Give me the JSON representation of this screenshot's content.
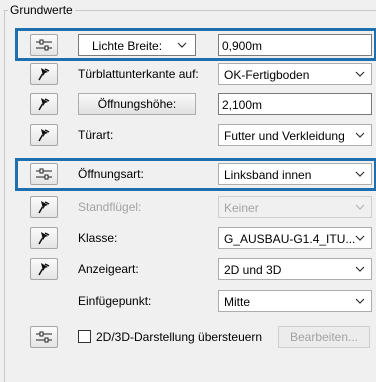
{
  "group": {
    "title": "Grundwerte"
  },
  "rows": {
    "lichte_breite": {
      "select_label": "Lichte Breite:",
      "value": "0,900m"
    },
    "tuerblatt": {
      "label": "Türblattunterkante auf:",
      "value": "OK-Fertigboden"
    },
    "oeffnungshoehe": {
      "button_label": "Öffnungshöhe:",
      "value": "2,100m"
    },
    "tuerart": {
      "label": "Türart:",
      "value": "Futter und Verkleidung"
    },
    "oeffnungsart": {
      "label": "Öffnungsart:",
      "value": "Linksband innen"
    },
    "standfluegel": {
      "label": "Standflügel:",
      "value": "Keiner"
    },
    "klasse": {
      "label": "Klasse:",
      "value": "G_AUSBAU-G1.4_ITU..."
    },
    "anzeigeart": {
      "label": "Anzeigeart:",
      "value": "2D und 3D"
    },
    "einfuegepunkt": {
      "label": "Einfügepunkt:",
      "value": "Mitte"
    },
    "override": {
      "label": "2D/3D-Darstellung übersteuern",
      "button_label": "Bearbeiten..."
    }
  },
  "icons": {
    "pin": "pin-icon",
    "slider": "slider-settings-icon",
    "chevron": "chevron-down-icon"
  },
  "colors": {
    "highlight": "#1e6fae",
    "disabled_text": "#a3a3a3",
    "dialog_background": "#f0f0f0"
  }
}
